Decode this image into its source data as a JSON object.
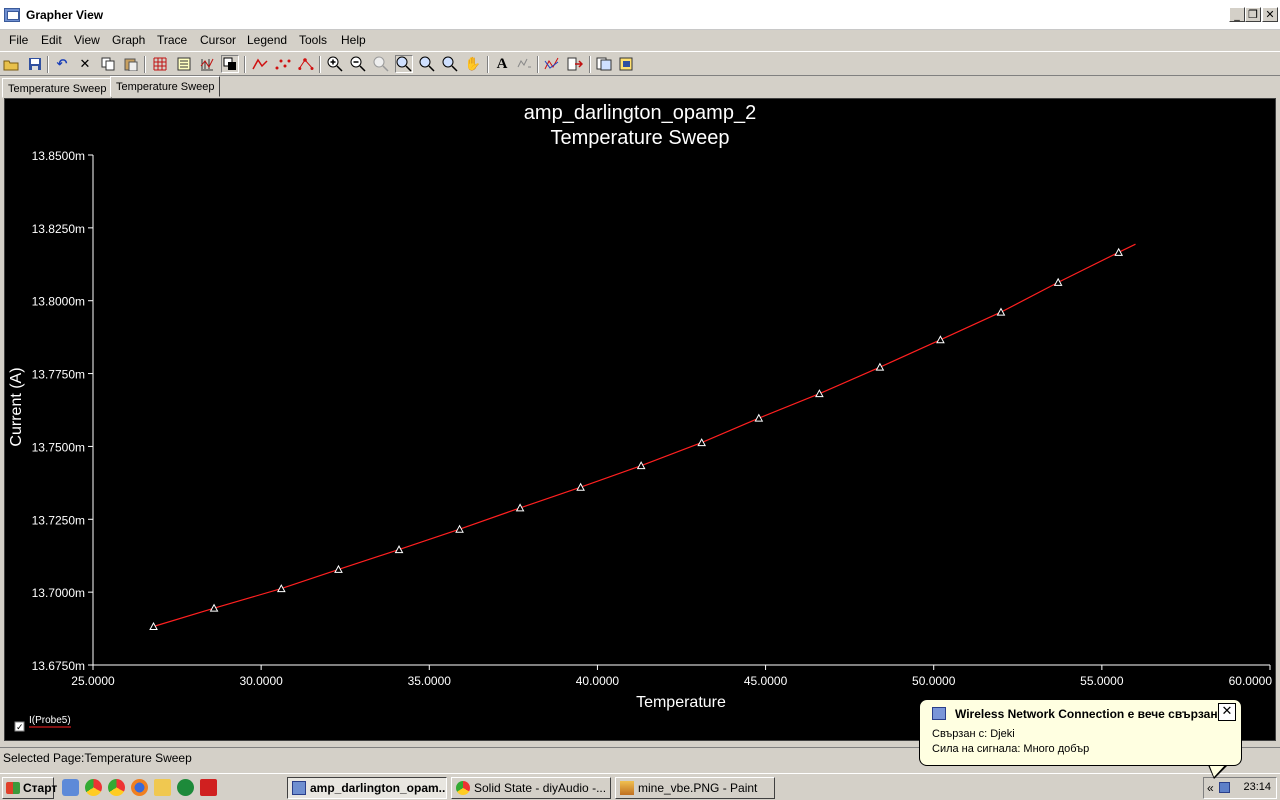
{
  "window": {
    "title": "Grapher View"
  },
  "window_controls": {
    "minimize": "_",
    "restore": "❐",
    "close": "✕"
  },
  "menu": [
    "File",
    "Edit",
    "View",
    "Graph",
    "Trace",
    "Cursor",
    "Legend",
    "Tools",
    "Help"
  ],
  "toolbar": {
    "icons": [
      "open-icon",
      "save-icon",
      "undo-icon",
      "cut-icon",
      "copy-icon",
      "paste-icon",
      "grid-icon",
      "legend-icon",
      "cursor-icon",
      "overlay-icon",
      "line-icon",
      "points-icon",
      "line-points-icon",
      "zoom-in-icon",
      "zoom-out-icon",
      "zoom-fit-icon",
      "zoom-area-icon",
      "zoom-x-icon",
      "zoom-y-icon",
      "pan-icon",
      "text-icon",
      "label-icon",
      "trace-icon",
      "export-icon",
      "copy-page-icon",
      "export-page-icon"
    ]
  },
  "tabs": [
    "Temperature Sweep",
    "Temperature Sweep"
  ],
  "chart_data": {
    "type": "line",
    "title": "amp_darlington_opamp_2",
    "subtitle": "Temperature Sweep",
    "xlabel": "Temperature",
    "ylabel": "Current (A)",
    "xlim": [
      25,
      60
    ],
    "ylim": [
      13.675,
      13.85
    ],
    "x_ticks": [
      25,
      30,
      35,
      40,
      45,
      50,
      55,
      60
    ],
    "x_tick_labels": [
      "25.0000",
      "30.0000",
      "35.0000",
      "40.0000",
      "45.0000",
      "50.0000",
      "55.0000",
      "60.0000"
    ],
    "y_ticks": [
      13.675,
      13.7,
      13.725,
      13.75,
      13.775,
      13.8,
      13.825,
      13.85
    ],
    "y_tick_labels": [
      "13.6750m",
      "13.7000m",
      "13.7250m",
      "13.7500m",
      "13.7750m",
      "13.8000m",
      "13.8250m",
      "13.8500m"
    ],
    "y_unit_note": "m",
    "background": "#000000",
    "line_color": "#ff2020",
    "marker": "triangle",
    "marker_color": "#ffffff",
    "series": [
      {
        "name": "I(Probe5)",
        "x": [
          26.8,
          28.6,
          30.6,
          32.3,
          34.1,
          35.9,
          37.7,
          39.5,
          41.3,
          43.1,
          44.8,
          46.6,
          48.4,
          50.2,
          52.0,
          53.7,
          55.5
        ],
        "y": [
          13.6882,
          13.6945,
          13.7012,
          13.7078,
          13.7146,
          13.7216,
          13.7289,
          13.736,
          13.7434,
          13.7513,
          13.7597,
          13.7681,
          13.7772,
          13.7866,
          13.7961,
          13.8063,
          13.8166
        ],
        "line_start": [
          26.8,
          13.6882
        ],
        "line_end": [
          56.0,
          13.8194
        ]
      }
    ],
    "grid": false,
    "legend": "bottom-left"
  },
  "legend": {
    "label": "I(Probe5)",
    "checked": true
  },
  "statusbar": {
    "text": "Selected Page:Temperature Sweep"
  },
  "taskbar": {
    "start_label": "Старт",
    "tasks": [
      {
        "label": "amp_darlington_opam...",
        "active": true
      },
      {
        "label": "Solid State - diyAudio -...",
        "active": false
      },
      {
        "label": "mine_vbe.PNG - Paint",
        "active": false
      }
    ],
    "tray_expand": "«",
    "clock": "23:14"
  },
  "balloon": {
    "title": "Wireless Network Connection е вече свързан",
    "line1": "Свързан с: Djeki",
    "line2": "Сила на сигнала: Много добър",
    "close": "✕"
  }
}
